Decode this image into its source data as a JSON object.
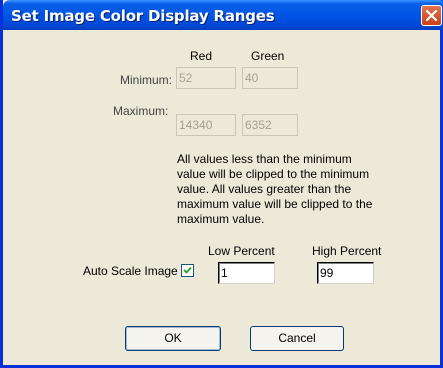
{
  "window": {
    "title": "Set Image Color Display Ranges"
  },
  "columns": {
    "red": "Red",
    "green": "Green"
  },
  "minimum": {
    "label": "Minimum:",
    "red": "52",
    "green": "40"
  },
  "maximum": {
    "label": "Maximum:",
    "red": "14340",
    "green": "6352"
  },
  "note": "All values less than the minimum value will be clipped to the minimum value.  All values greater than the maximum value will be clipped to the maximum value.",
  "autoscale": {
    "label": "Auto Scale Image",
    "checked": true,
    "low_label": "Low Percent",
    "low_value": "1",
    "high_label": "High Percent",
    "high_value": "99"
  },
  "buttons": {
    "ok": "OK",
    "cancel": "Cancel"
  },
  "icons": {
    "close": "close-icon",
    "check": "checkmark-icon"
  }
}
